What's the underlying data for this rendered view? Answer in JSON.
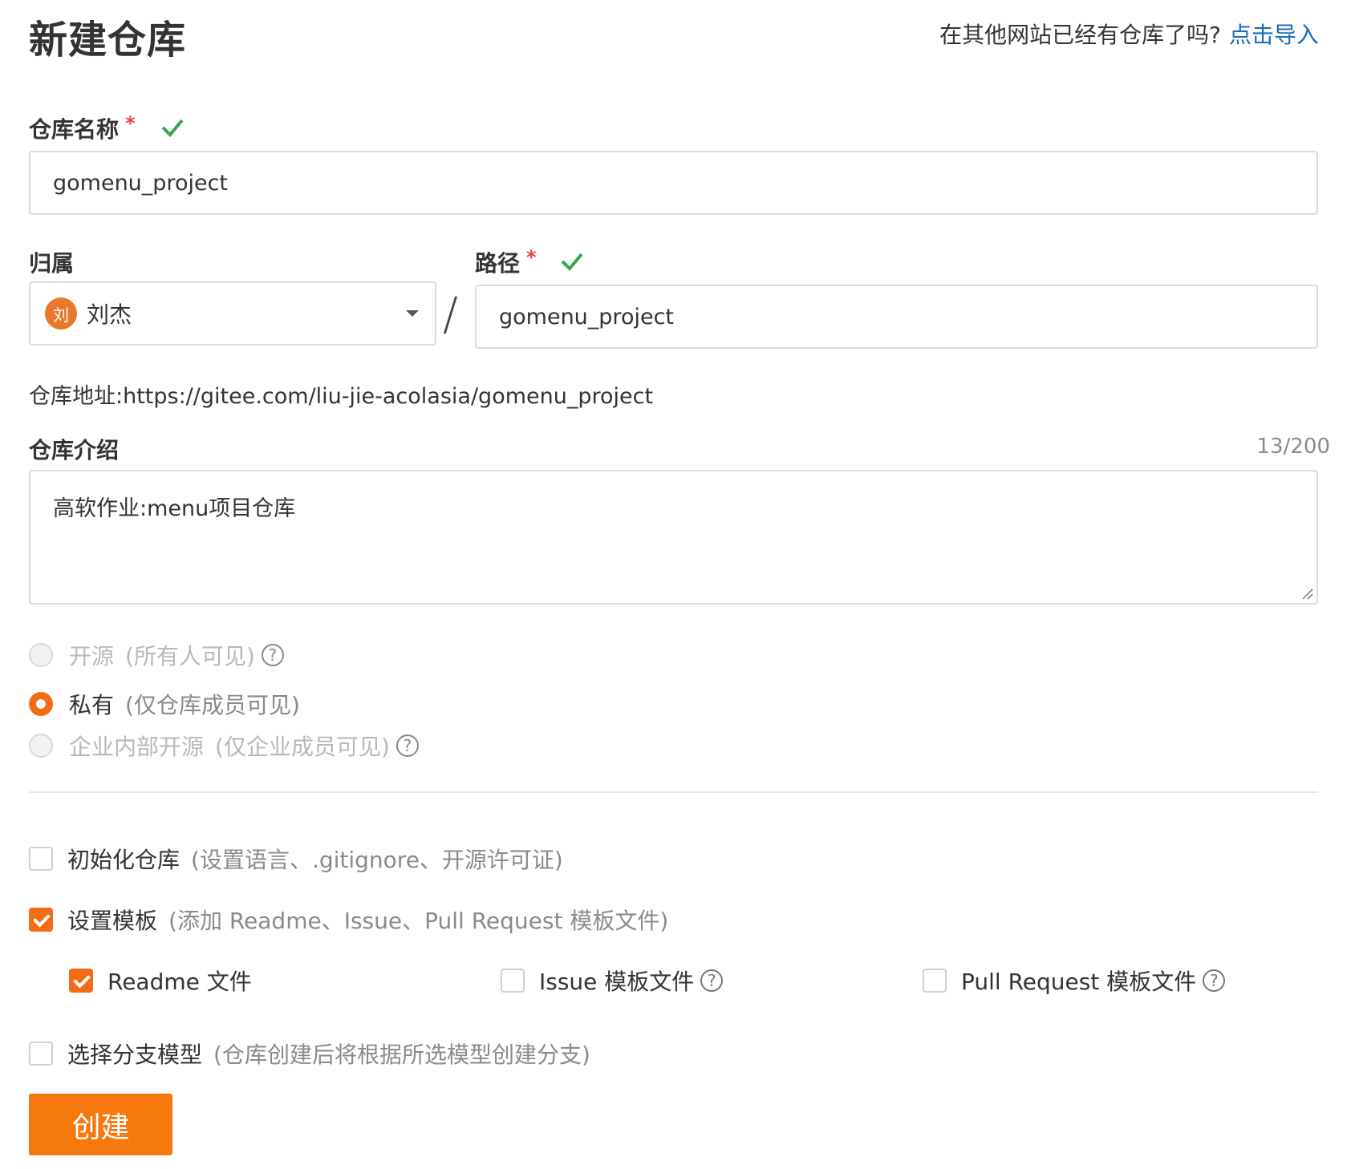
{
  "page": {
    "title": "新建仓库",
    "import_prompt": "在其他网站已经有仓库了吗?",
    "import_link": "点击导入"
  },
  "repo_name": {
    "label": "仓库名称",
    "required_mark": "*",
    "value": "gomenu_project"
  },
  "owner": {
    "label": "归属",
    "avatar_text": "刘",
    "avatar_color": "#e8792a",
    "selected": "刘杰"
  },
  "separator": "/",
  "path": {
    "label": "路径",
    "required_mark": "*",
    "value": "gomenu_project"
  },
  "repo_address": "仓库地址:https://gitee.com/liu-jie-acolasia/gomenu_project",
  "description": {
    "label": "仓库介绍",
    "counter": "13/200",
    "value": "高软作业:menu项目仓库"
  },
  "visibility": {
    "options": [
      {
        "label": "开源",
        "hint": "(所有人可见)",
        "selected": false,
        "disabled": true
      },
      {
        "label": "私有",
        "hint": "(仅仓库成员可见)",
        "selected": true,
        "disabled": false
      },
      {
        "label": "企业内部开源",
        "hint": "(仅企业成员可见)",
        "selected": false,
        "disabled": true
      }
    ]
  },
  "init_repo": {
    "label": "初始化仓库",
    "hint": "(设置语言、.gitignore、开源许可证)",
    "checked": false
  },
  "template": {
    "label": "设置模板",
    "hint": "(添加 Readme、Issue、Pull Request 模板文件)",
    "checked": true
  },
  "template_files": [
    {
      "label": "Readme 文件",
      "checked": true
    },
    {
      "label": "Issue 模板文件",
      "checked": false
    },
    {
      "label": "Pull Request 模板文件",
      "checked": false
    }
  ],
  "branch_model": {
    "label": "选择分支模型",
    "hint": "(仓库创建后将根据所选模型创建分支)",
    "checked": false
  },
  "help_glyph": "?",
  "create_button": "创建",
  "colors": {
    "accent": "#f36b14",
    "link": "#1a6bb8",
    "valid": "#3aa64a",
    "required": "#e6463c"
  }
}
